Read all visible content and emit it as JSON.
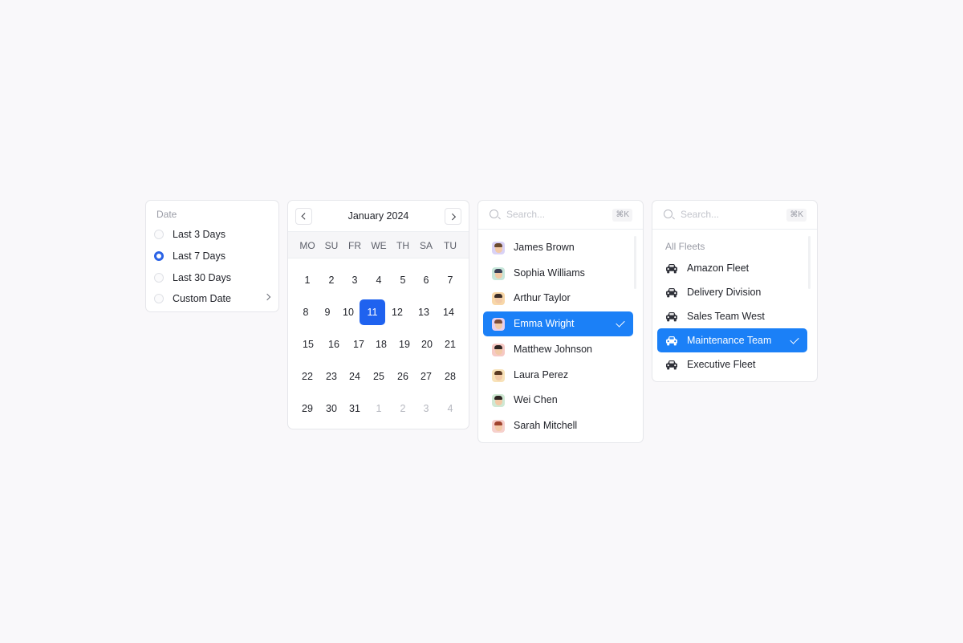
{
  "date_filter": {
    "label": "Date",
    "options": [
      {
        "label": "Last 3 Days",
        "selected": false
      },
      {
        "label": "Last 7 Days",
        "selected": true
      },
      {
        "label": "Last 30 Days",
        "selected": false
      },
      {
        "label": "Custom Date",
        "selected": false,
        "has_submenu": true
      }
    ]
  },
  "calendar": {
    "title": "January 2024",
    "weekdays": [
      "MO",
      "SU",
      "FR",
      "WE",
      "TH",
      "SA",
      "TU"
    ],
    "weeks": [
      [
        "1",
        "2",
        "3",
        "4",
        "5",
        "6",
        "7"
      ],
      [
        "8",
        "9",
        "10",
        "11",
        "12",
        "13",
        "14"
      ],
      [
        "15",
        "16",
        "17",
        "18",
        "19",
        "20",
        "21"
      ],
      [
        "22",
        "23",
        "24",
        "25",
        "26",
        "27",
        "28"
      ],
      [
        "29",
        "30",
        "31",
        "1",
        "2",
        "3",
        "4"
      ]
    ],
    "selected_day": "11",
    "muted_trailing_days": 4
  },
  "people_dropdown": {
    "search_placeholder": "Search...",
    "shortcut": "⌘K",
    "items": [
      {
        "name": "James Brown",
        "selected": false,
        "bg": "#d9d2f6",
        "hair": "#6b4a2f"
      },
      {
        "name": "Sophia Williams",
        "selected": false,
        "bg": "#c7e6da",
        "hair": "#3b3f55"
      },
      {
        "name": "Arthur Taylor",
        "selected": false,
        "bg": "#f8d7a8",
        "hair": "#3a2c28"
      },
      {
        "name": "Emma Wright",
        "selected": true,
        "bg": "#e6cfee",
        "hair": "#7a4a3a"
      },
      {
        "name": "Matthew Johnson",
        "selected": false,
        "bg": "#f6c9c4",
        "hair": "#2d2320"
      },
      {
        "name": "Laura Perez",
        "selected": false,
        "bg": "#f8e2b8",
        "hair": "#5b3a22"
      },
      {
        "name": "Wei Chen",
        "selected": false,
        "bg": "#cfe8d3",
        "hair": "#2d2320"
      },
      {
        "name": "Sarah Mitchell",
        "selected": false,
        "bg": "#f6d0cc",
        "hair": "#a0442e"
      }
    ]
  },
  "fleet_dropdown": {
    "search_placeholder": "Search...",
    "shortcut": "⌘K",
    "group_label": "All Fleets",
    "items": [
      {
        "name": "Amazon Fleet",
        "selected": false
      },
      {
        "name": "Delivery Division",
        "selected": false
      },
      {
        "name": "Sales Team West",
        "selected": false
      },
      {
        "name": "Maintenance Team",
        "selected": true
      },
      {
        "name": "Executive Fleet",
        "selected": false
      }
    ]
  },
  "colors": {
    "accent": "#1b80f7",
    "calendar_selected": "#1f62ef",
    "radio_selected": "#2b63e6"
  }
}
